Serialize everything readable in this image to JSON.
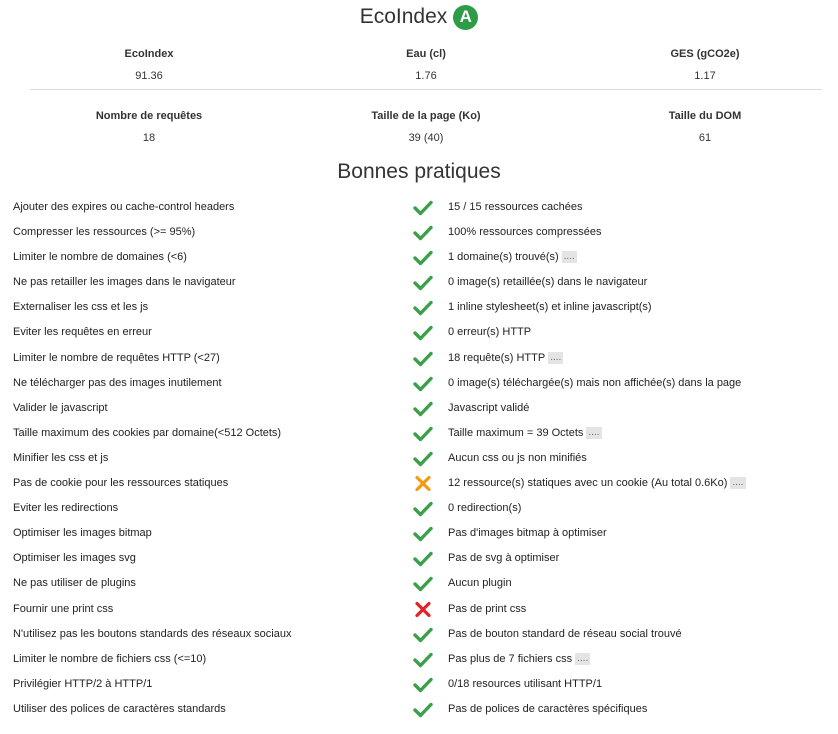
{
  "header": {
    "title": "EcoIndex",
    "grade": "A"
  },
  "colors": {
    "ok": "#3aa14a",
    "warning": "#f39c12",
    "error": "#e0242a",
    "grade": "#2e9b46"
  },
  "metrics": [
    {
      "label": "EcoIndex",
      "value": "91.36"
    },
    {
      "label": "Eau (cl)",
      "value": "1.76"
    },
    {
      "label": "GES (gCO2e)",
      "value": "1.17"
    },
    {
      "label": "Nombre de requêtes",
      "value": "18"
    },
    {
      "label": "Taille de la page (Ko)",
      "value": "39 (40)"
    },
    {
      "label": "Taille du DOM",
      "value": "61"
    }
  ],
  "practices_title": "Bonnes pratiques",
  "more_label": "....",
  "practices": [
    {
      "name": "Ajouter des expires ou cache-control headers",
      "status": "ok",
      "result": "15 / 15 ressources cachées",
      "more": false
    },
    {
      "name": "Compresser les ressources (>= 95%)",
      "status": "ok",
      "result": "100% ressources compressées",
      "more": false
    },
    {
      "name": "Limiter le nombre de domaines (<6)",
      "status": "ok",
      "result": "1 domaine(s) trouvé(s)",
      "more": true
    },
    {
      "name": "Ne pas retailler les images dans le navigateur",
      "status": "ok",
      "result": "0 image(s) retaillée(s) dans le navigateur",
      "more": false
    },
    {
      "name": "Externaliser les css et les js",
      "status": "ok",
      "result": "1 inline stylesheet(s) et inline javascript(s)",
      "more": false
    },
    {
      "name": "Eviter les requêtes en erreur",
      "status": "ok",
      "result": "0 erreur(s) HTTP",
      "more": false
    },
    {
      "name": "Limiter le nombre de requêtes HTTP (<27)",
      "status": "ok",
      "result": "18 requête(s) HTTP",
      "more": true
    },
    {
      "name": "Ne télécharger pas des images inutilement",
      "status": "ok",
      "result": "0 image(s) téléchargée(s) mais non affichée(s) dans la page",
      "more": false
    },
    {
      "name": "Valider le javascript",
      "status": "ok",
      "result": "Javascript validé",
      "more": false
    },
    {
      "name": "Taille maximum des cookies par domaine(<512 Octets)",
      "status": "ok",
      "result": "Taille maximum = 39 Octets",
      "more": true
    },
    {
      "name": "Minifier les css et js",
      "status": "ok",
      "result": "Aucun css ou js non minifiés",
      "more": false
    },
    {
      "name": "Pas de cookie pour les ressources statiques",
      "status": "warning",
      "result": "12 ressource(s) statiques avec un cookie (Au total 0.6Ko)",
      "more": true
    },
    {
      "name": "Eviter les redirections",
      "status": "ok",
      "result": "0 redirection(s)",
      "more": false
    },
    {
      "name": "Optimiser les images bitmap",
      "status": "ok",
      "result": "Pas d'images bitmap à optimiser",
      "more": false
    },
    {
      "name": "Optimiser les images svg",
      "status": "ok",
      "result": "Pas de svg à optimiser",
      "more": false
    },
    {
      "name": "Ne pas utiliser de plugins",
      "status": "ok",
      "result": "Aucun plugin",
      "more": false
    },
    {
      "name": "Fournir une print css",
      "status": "error",
      "result": "Pas de print css",
      "more": false
    },
    {
      "name": "N'utilisez pas les boutons standards des réseaux sociaux",
      "status": "ok",
      "result": "Pas de bouton standard de réseau social trouvé",
      "more": false
    },
    {
      "name": "Limiter le nombre de fichiers css (<=10)",
      "status": "ok",
      "result": "Pas plus de 7 fichiers css",
      "more": true
    },
    {
      "name": "Privilégier HTTP/2 à HTTP/1",
      "status": "ok",
      "result": "0/18 resources utilisant HTTP/1",
      "more": false
    },
    {
      "name": "Utiliser des polices de caractères standards",
      "status": "ok",
      "result": "Pas de polices de caractères spécifiques",
      "more": false
    }
  ]
}
